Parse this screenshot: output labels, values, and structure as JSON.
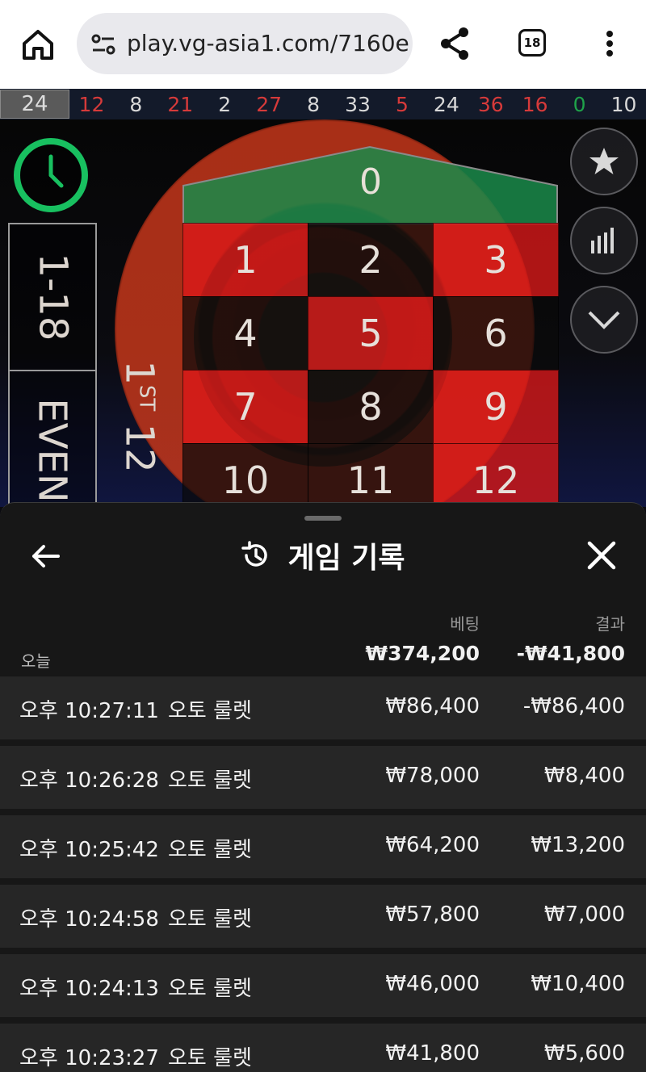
{
  "browser": {
    "url": "play.vg-asia1.com/7160e",
    "tab_count": "18"
  },
  "results_strip": {
    "current": "24",
    "history": [
      {
        "n": "12",
        "color": "#d63a3a"
      },
      {
        "n": "8",
        "color": "#d8d8d8"
      },
      {
        "n": "21",
        "color": "#d63a3a"
      },
      {
        "n": "2",
        "color": "#d8d8d8"
      },
      {
        "n": "27",
        "color": "#d63a3a"
      },
      {
        "n": "8",
        "color": "#d8d8d8"
      },
      {
        "n": "33",
        "color": "#d8d8d8"
      },
      {
        "n": "5",
        "color": "#d63a3a"
      },
      {
        "n": "24",
        "color": "#d8d8d8"
      },
      {
        "n": "36",
        "color": "#d63a3a"
      },
      {
        "n": "16",
        "color": "#d63a3a"
      },
      {
        "n": "0",
        "color": "#1fa34a"
      },
      {
        "n": "10",
        "color": "#d8d8d8"
      }
    ]
  },
  "table": {
    "zero": "0",
    "numbers": [
      {
        "n": "1",
        "color": "red"
      },
      {
        "n": "2",
        "color": "black"
      },
      {
        "n": "3",
        "color": "red"
      },
      {
        "n": "4",
        "color": "black"
      },
      {
        "n": "5",
        "color": "red"
      },
      {
        "n": "6",
        "color": "black"
      },
      {
        "n": "7",
        "color": "red"
      },
      {
        "n": "8",
        "color": "black"
      },
      {
        "n": "9",
        "color": "red"
      },
      {
        "n": "10",
        "color": "black"
      },
      {
        "n": "11",
        "color": "black"
      },
      {
        "n": "12",
        "color": "red"
      }
    ],
    "bet_low": "1-18",
    "bet_even": "EVEN",
    "dozen_number": "1",
    "dozen_suffix": "ST",
    "dozen_count": "12"
  },
  "panel": {
    "title": "게임 기록",
    "col_bet": "베팅",
    "col_result": "결과",
    "today_label": "오늘",
    "today_bet": "₩374,200",
    "today_result": "-₩41,800",
    "rows": [
      {
        "time": "오후 10:27:11",
        "game": "오토 룰렛",
        "bet": "₩86,400",
        "result": "-₩86,400"
      },
      {
        "time": "오후 10:26:28",
        "game": "오토 룰렛",
        "bet": "₩78,000",
        "result": "₩8,400"
      },
      {
        "time": "오후 10:25:42",
        "game": "오토 룰렛",
        "bet": "₩64,200",
        "result": "₩13,200"
      },
      {
        "time": "오후 10:24:58",
        "game": "오토 룰렛",
        "bet": "₩57,800",
        "result": "₩7,000"
      },
      {
        "time": "오후 10:24:13",
        "game": "오토 룰렛",
        "bet": "₩46,000",
        "result": "₩10,400"
      },
      {
        "time": "오후 10:23:27",
        "game": "오토 룰렛",
        "bet": "₩41,800",
        "result": "₩5,600"
      }
    ]
  },
  "colors": {
    "red_number": "#d63a3a",
    "green_number": "#1fa34a",
    "zero_felt": "#1a8a4a",
    "timer_ring": "#18c060",
    "trophy_tab": "#2a64d8"
  },
  "icons": {
    "home": "home-icon",
    "site_settings": "tune-icon",
    "share": "share-icon",
    "more": "more-vertical-icon",
    "timer": "clock-icon",
    "favorites": "star-icon",
    "statistics": "bar-chart-icon",
    "collapse": "chevron-down-icon",
    "back": "arrow-left-icon",
    "history": "history-icon",
    "close": "close-icon",
    "trophy": "trophy-icon"
  }
}
